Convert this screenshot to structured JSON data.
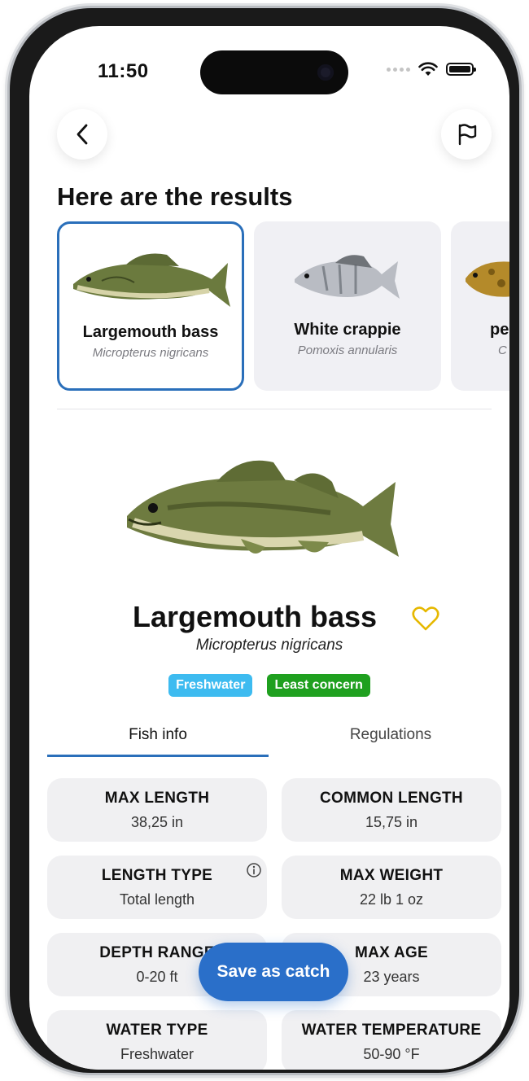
{
  "status_bar": {
    "time": "11:50"
  },
  "header": {
    "back_icon": "chevron-left-icon",
    "report_icon": "flag-icon"
  },
  "results": {
    "title": "Here are the results",
    "cards": [
      {
        "name": "Largemouth bass",
        "scientific": "Micropterus nigricans",
        "selected": true
      },
      {
        "name": "White crappie",
        "scientific": "Pomoxis annularis",
        "selected": false
      },
      {
        "name": "pe",
        "scientific": "C",
        "selected": false
      }
    ]
  },
  "species": {
    "name": "Largemouth bass",
    "scientific": "Micropterus nigricans",
    "favorite_icon": "heart-icon",
    "tags": [
      {
        "label": "Freshwater",
        "color": "#3dbbf0"
      },
      {
        "label": "Least concern",
        "color": "#1fa01f"
      }
    ]
  },
  "tabs": [
    {
      "label": "Fish info",
      "active": true
    },
    {
      "label": "Regulations",
      "active": false
    }
  ],
  "stats": [
    {
      "label": "MAX LENGTH",
      "value": "38,25 in"
    },
    {
      "label": "COMMON LENGTH",
      "value": "15,75 in"
    },
    {
      "label": "LENGTH TYPE",
      "value": "Total length",
      "info": true
    },
    {
      "label": "MAX WEIGHT",
      "value": "22 lb 1 oz"
    },
    {
      "label": "DEPTH RANGE",
      "value": "0-20 ft"
    },
    {
      "label": "MAX AGE",
      "value": "23 years"
    },
    {
      "label": "WATER TYPE",
      "value": "Freshwater"
    },
    {
      "label": "WATER TEMPERATURE",
      "value": "50-90 °F"
    }
  ],
  "actions": {
    "save_label": "Save as catch"
  },
  "colors": {
    "accent": "#2a6fc9",
    "selected_border": "#2a6fba",
    "heart": "#e6b800"
  }
}
